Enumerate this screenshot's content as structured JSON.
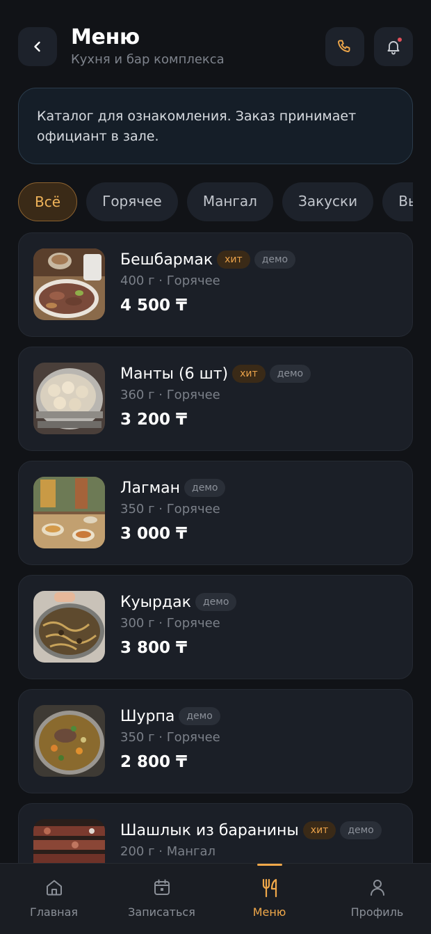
{
  "header": {
    "title": "Меню",
    "subtitle": "Кухня и бар комплекса"
  },
  "notice": {
    "text": "Каталог для ознакомления. Заказ принимает официант в зале."
  },
  "categories": [
    "Всё",
    "Горячее",
    "Мангал",
    "Закуски",
    "Вып"
  ],
  "active_category": "Всё",
  "dishes": [
    {
      "name": "Бешбармак",
      "hit": "хит",
      "demo": "демо",
      "meta": "400 г · Горячее",
      "price": "4 500 ₸"
    },
    {
      "name": "Манты (6 шт)",
      "hit": "хит",
      "demo": "демо",
      "meta": "360 г · Горячее",
      "price": "3 200 ₸"
    },
    {
      "name": "Лагман",
      "hit": "",
      "demo": "демо",
      "meta": "350 г · Горячее",
      "price": "3 000 ₸"
    },
    {
      "name": "Куырдак",
      "hit": "",
      "demo": "демо",
      "meta": "300 г · Горячее",
      "price": "3 800 ₸"
    },
    {
      "name": "Шурпа",
      "hit": "",
      "demo": "демо",
      "meta": "350 г · Горячее",
      "price": "2 800 ₸"
    },
    {
      "name": "Шашлык из баранины",
      "hit": "хит",
      "demo": "демо",
      "meta": "200 г · Мангал",
      "price": ""
    }
  ],
  "tabbar": {
    "items": [
      {
        "label": "Главная",
        "icon": "home-icon"
      },
      {
        "label": "Записаться",
        "icon": "calendar-icon"
      },
      {
        "label": "Меню",
        "icon": "fork-knife-icon"
      },
      {
        "label": "Профиль",
        "icon": "user-icon"
      }
    ],
    "active": "Меню"
  },
  "colors": {
    "background": "#111317",
    "card": "#1b1f27",
    "accent": "#f0a84a",
    "notification_dot": "#e0505a"
  }
}
